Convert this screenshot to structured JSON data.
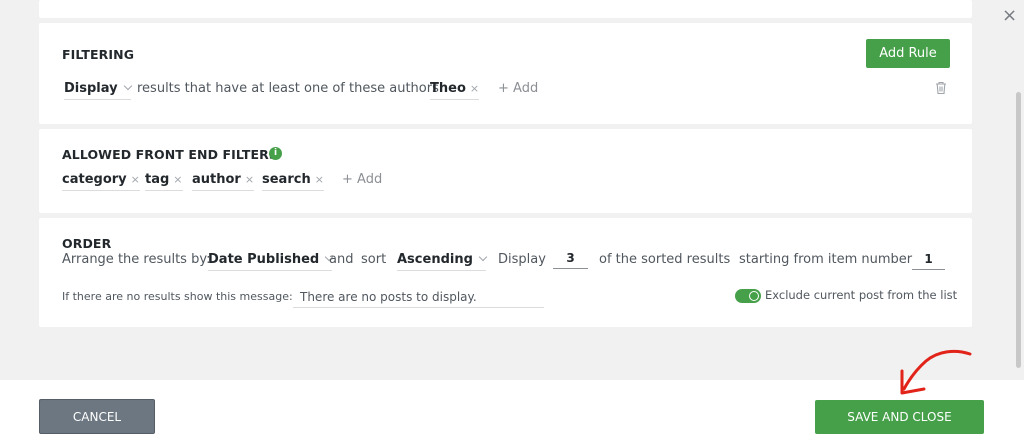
{
  "filtering": {
    "heading": "FILTERING",
    "add_rule": "Add Rule",
    "display_select": "Display",
    "rule_text": "results that have at least one of these authors",
    "author_token": "Theo",
    "add_label": "+ Add"
  },
  "allowed_filters": {
    "heading": "ALLOWED FRONT END FILTERS",
    "info_glyph": "i",
    "tokens": [
      "category",
      "tag",
      "author",
      "search"
    ],
    "add_label": "+ Add"
  },
  "order": {
    "heading": "ORDER",
    "arrange_label": "Arrange the results by:",
    "order_by": "Date Published",
    "and_label": "and",
    "sort_label": "sort",
    "sort_direction": "Ascending",
    "display_label": "Display",
    "display_count": "3",
    "sorted_label": "of the sorted results",
    "starting_label": "starting from item number",
    "start_item": "1",
    "no_results_label": "If there are no results show this message:",
    "no_results_message": "There are no posts to display.",
    "exclude_label": "Exclude current post from the list",
    "exclude_enabled": true
  },
  "footer": {
    "cancel": "CANCEL",
    "save": "SAVE AND CLOSE"
  },
  "icons": {
    "close": "×",
    "remove": "×",
    "trash": "trash-icon",
    "info": "info-icon",
    "check": "✓"
  },
  "colors": {
    "accent_green": "#46a049",
    "cancel_gray": "#6c7781",
    "annotation_red": "#e2231a"
  }
}
